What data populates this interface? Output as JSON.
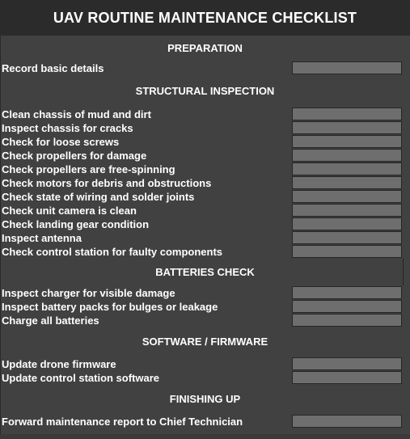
{
  "title": "UAV ROUTINE MAINTENANCE CHECKLIST",
  "sections": [
    {
      "header": "PREPARATION",
      "items": [
        "Record basic details"
      ]
    },
    {
      "header": "STRUCTURAL INSPECTION",
      "items": [
        "Clean chassis of mud and dirt",
        "Inspect chassis for cracks",
        "Check for loose screws",
        "Check propellers for damage",
        "Check propellers are free-spinning",
        "Check motors for debris and obstructions",
        "Check state of wiring and solder joints",
        "Check unit camera is clean",
        "Check landing gear condition",
        "Inspect antenna",
        "Check control station for faulty components"
      ]
    },
    {
      "header": "BATTERIES CHECK",
      "items": [
        "Inspect charger for visible damage",
        "Inspect battery packs for bulges or leakage",
        "Charge all batteries"
      ]
    },
    {
      "header": "SOFTWARE / FIRMWARE",
      "items": [
        "Update drone firmware",
        "Update control station software"
      ]
    },
    {
      "header": "FINISHING UP",
      "items": [
        "Forward maintenance report to Chief Technician"
      ]
    }
  ],
  "colors": {
    "background": "#414141",
    "title_bar": "#2b2b2b",
    "input_box": "#6e6e6e",
    "text": "#ffffff"
  }
}
